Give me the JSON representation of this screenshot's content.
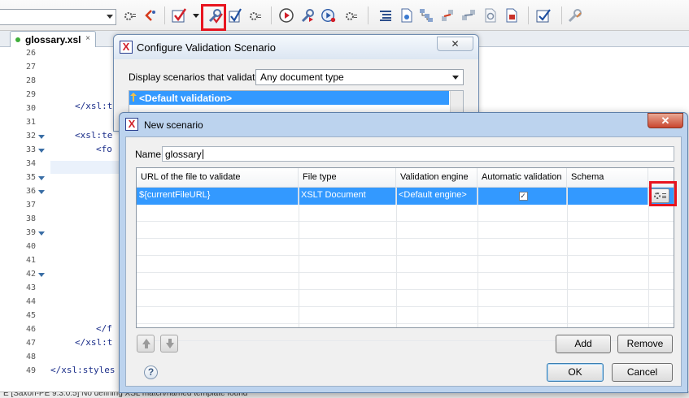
{
  "editor": {
    "tab_label": "glossary.xsl",
    "tab_close": "×",
    "line_numbers": [
      "26",
      "27",
      "28",
      "29",
      "30",
      "31",
      "32",
      "33",
      "34",
      "35",
      "36",
      "37",
      "38",
      "39",
      "40",
      "41",
      "42",
      "43",
      "44",
      "45",
      "46",
      "47",
      "48",
      "49"
    ],
    "code": {
      "l30": "</xsl:t",
      "l32": "<xsl:te",
      "l33": "<fo",
      "l46": "</f",
      "l47": "</xsl:t",
      "l49": "</xsl:styles"
    },
    "status_text": "E [Saxon-PE 9.3.0.5] No defining XSL match/named template found"
  },
  "dialog_configure": {
    "title": "Configure Validation Scenario",
    "close_label": "✕",
    "filter_label": "Display scenarios that validate:",
    "filter_value": "Any document type",
    "selected_item": "<Default validation>"
  },
  "dialog_new": {
    "title": "New scenario",
    "close_label": "✕",
    "name_label": "Name",
    "name_value": "glossary",
    "columns": [
      "URL of the file to validate",
      "File type",
      "Validation engine",
      "Automatic validation",
      "Schema"
    ],
    "rows": [
      {
        "url": "${currentFileURL}",
        "file_type": "XSLT Document",
        "engine": "<Default engine>",
        "automatic": true,
        "schema": ""
      }
    ],
    "add_label": "Add",
    "remove_label": "Remove",
    "ok_label": "OK",
    "cancel_label": "Cancel",
    "help_label": "?",
    "check_mark": "✓"
  },
  "colors": {
    "highlight_frame": "#e8141f",
    "selection": "#3399ff"
  },
  "toolbar_icons": [
    "combo-dropdown",
    "settings-gear",
    "arrow-back",
    "validate-check",
    "dropdown-arrow",
    "configure-validation-wrench",
    "validate-all",
    "gear",
    "run-transform",
    "configure-transform",
    "debug-play",
    "gear",
    "indent",
    "document",
    "xml-tree",
    "diff",
    "refresh-doc",
    "print-doc",
    "sign-check",
    "tools"
  ]
}
